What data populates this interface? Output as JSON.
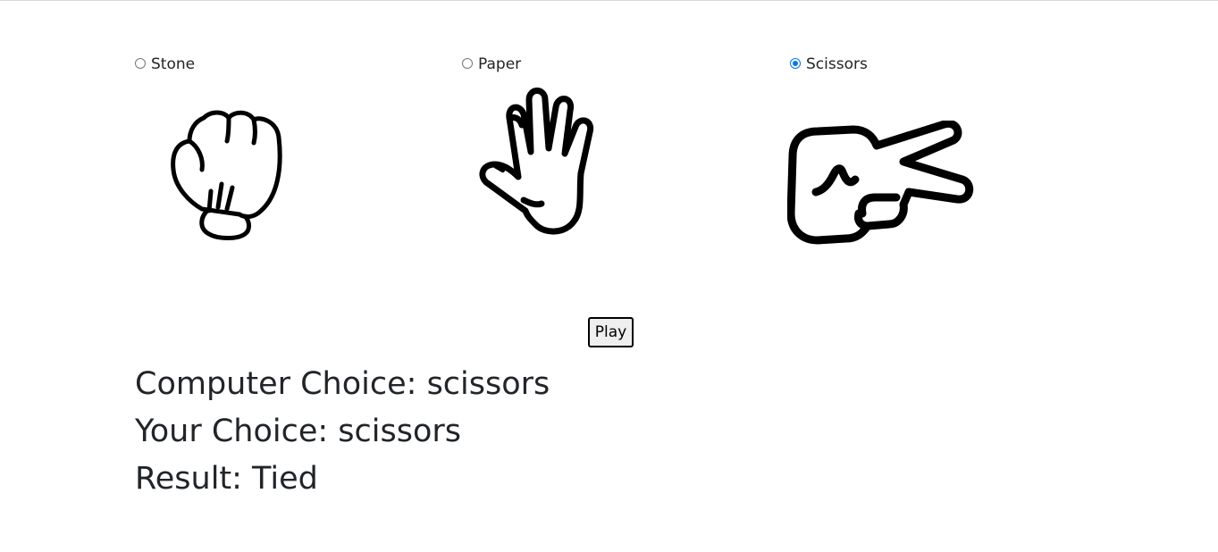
{
  "options": [
    {
      "label": "Stone",
      "checked": false
    },
    {
      "label": "Paper",
      "checked": false
    },
    {
      "label": "Scissors",
      "checked": true
    }
  ],
  "play_label": "Play",
  "results": {
    "computer_choice": "Computer Choice: scissors",
    "your_choice": "Your Choice: scissors",
    "result": "Result: Tied"
  },
  "colors": {
    "radio_accent": "#0075ff",
    "text": "#212529"
  }
}
